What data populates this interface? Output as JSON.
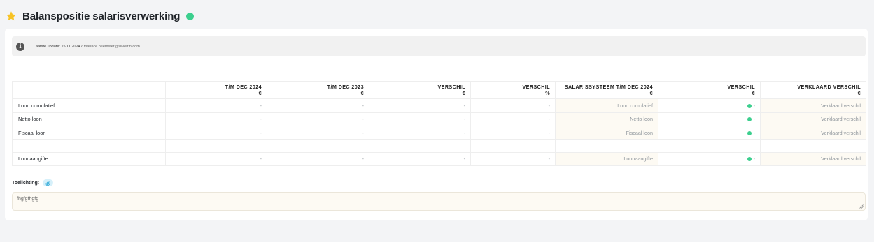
{
  "header": {
    "title": "Balanspositie salarisverwerking",
    "status_color": "#3ccf8e",
    "star_icon": "star-icon"
  },
  "info": {
    "icon": "info-icon",
    "text": "Laatste update: 15/11/2024 /",
    "email": "maurice.beemster@silverfin.com"
  },
  "table": {
    "columns": [
      {
        "label": "",
        "unit": ""
      },
      {
        "label": "T/M DEC 2024",
        "unit": "€"
      },
      {
        "label": "T/M DEC 2023",
        "unit": "€"
      },
      {
        "label": "VERSCHIL",
        "unit": "€"
      },
      {
        "label": "VERSCHIL",
        "unit": "%"
      },
      {
        "label": "SALARISSYSTEEM T/M DEC 2024",
        "unit": "€"
      },
      {
        "label": "VERSCHIL",
        "unit": "€"
      },
      {
        "label": "VERKLAARD VERSCHIL",
        "unit": "€"
      }
    ],
    "rows": [
      {
        "label": "Loon cumulatief",
        "dec2024": "-",
        "dec2023": "-",
        "verschil": "-",
        "verschil_pct": "-",
        "salarissysteem": "Loon cumulatief",
        "verschil2": "-",
        "verklaard": "Verklaard verschil"
      },
      {
        "label": "Netto loon",
        "dec2024": "-",
        "dec2023": "-",
        "verschil": "-",
        "verschil_pct": "-",
        "salarissysteem": "Netto loon",
        "verschil2": "-",
        "verklaard": "Verklaard verschil"
      },
      {
        "label": "Fiscaal loon",
        "dec2024": "-",
        "dec2023": "-",
        "verschil": "-",
        "verschil_pct": "-",
        "salarissysteem": "Fiscaal loon",
        "verschil2": "-",
        "verklaard": "Verklaard verschil"
      },
      {
        "label": "Loonaangifte",
        "dec2024": "-",
        "dec2023": "-",
        "verschil": "-",
        "verschil_pct": "-",
        "salarissysteem": "Loonaangifte",
        "verschil2": "-",
        "verklaard": "Verklaard verschil"
      }
    ]
  },
  "toelichting": {
    "label": "Toelichting:",
    "attach_icon": "paperclip-icon",
    "value": "fhgfgfhgfg"
  },
  "colors": {
    "accent_green": "#3ccf8e",
    "input_bg": "#fdfaf3",
    "star": "#f7c325"
  }
}
